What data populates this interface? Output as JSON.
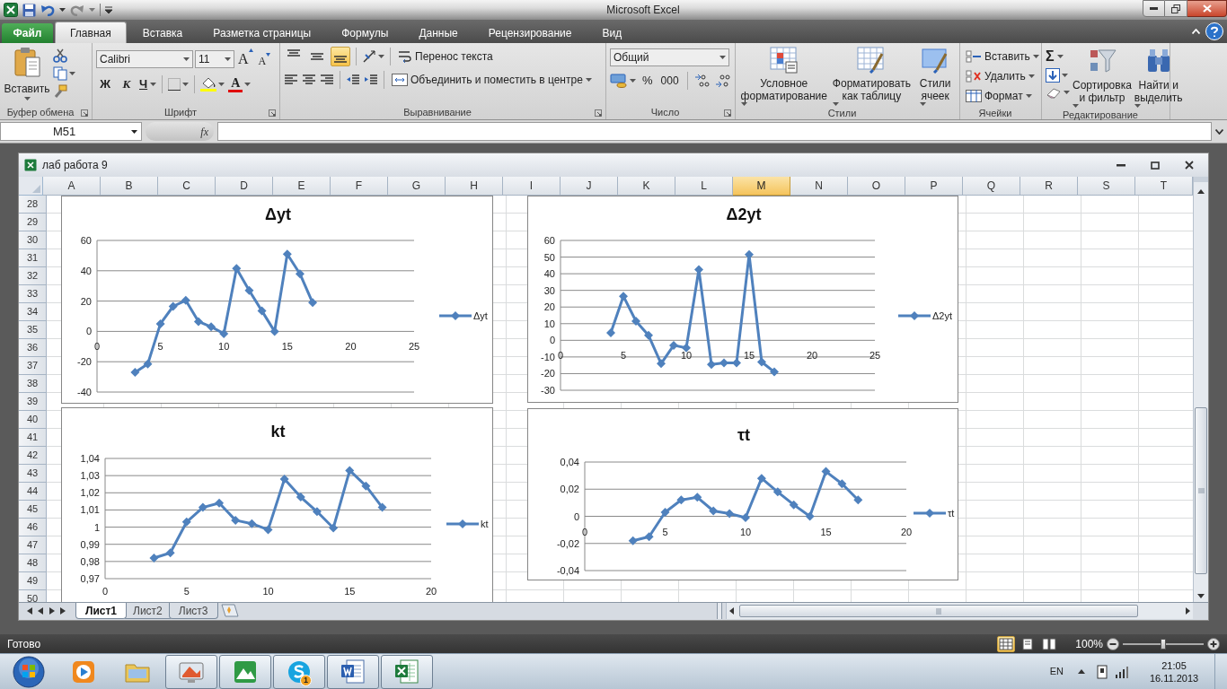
{
  "title_bar": {
    "title": "Microsoft Excel"
  },
  "ribbon_tabs": [
    {
      "label": "Файл",
      "kind": "file",
      "selected": false
    },
    {
      "label": "Главная",
      "kind": "tab",
      "selected": true
    },
    {
      "label": "Вставка",
      "kind": "tab",
      "selected": false
    },
    {
      "label": "Разметка страницы",
      "kind": "tab",
      "selected": false
    },
    {
      "label": "Формулы",
      "kind": "tab",
      "selected": false
    },
    {
      "label": "Данные",
      "kind": "tab",
      "selected": false
    },
    {
      "label": "Рецензирование",
      "kind": "tab",
      "selected": false
    },
    {
      "label": "Вид",
      "kind": "tab",
      "selected": false
    }
  ],
  "clipboard": {
    "paste": "Вставить",
    "group": "Буфер обмена"
  },
  "font": {
    "name": "Calibri",
    "size": "11",
    "grow": "A",
    "shrink": "A",
    "bold": "Ж",
    "italic": "К",
    "underline": "Ч",
    "color_letter": "A",
    "group": "Шрифт"
  },
  "alignment": {
    "vertical": [
      {
        "selected": false
      },
      {
        "selected": false
      },
      {
        "selected": true
      }
    ],
    "wrap": "Перенос текста",
    "merge": "Объединить и поместить в центре",
    "group": "Выравнивание"
  },
  "number": {
    "format": "Общий",
    "percent": "%",
    "thousands": "000",
    "group": "Число"
  },
  "styles": {
    "conditional": "Условное\nформатирование",
    "as_table": "Форматировать\nкак таблицу",
    "cell_styles": "Стили\nячеек",
    "group": "Стили"
  },
  "cells": {
    "insert": "Вставить",
    "delete": "Удалить",
    "format": "Формат",
    "group": "Ячейки"
  },
  "editing": {
    "sum": "Σ",
    "sort": "Сортировка\nи фильтр",
    "find": "Найти и\nвыделить",
    "group": "Редактирование"
  },
  "formula_bar": {
    "name_box": "M51",
    "function": "fx"
  },
  "workbook": {
    "title": "лаб работа 9",
    "columns": [
      {
        "label": "A",
        "selected": false
      },
      {
        "label": "B",
        "selected": false
      },
      {
        "label": "C",
        "selected": false
      },
      {
        "label": "D",
        "selected": false
      },
      {
        "label": "E",
        "selected": false
      },
      {
        "label": "F",
        "selected": false
      },
      {
        "label": "G",
        "selected": false
      },
      {
        "label": "H",
        "selected": false
      },
      {
        "label": "I",
        "selected": false
      },
      {
        "label": "J",
        "selected": false
      },
      {
        "label": "K",
        "selected": false
      },
      {
        "label": "L",
        "selected": false
      },
      {
        "label": "M",
        "selected": true
      },
      {
        "label": "N",
        "selected": false
      },
      {
        "label": "O",
        "selected": false
      },
      {
        "label": "P",
        "selected": false
      },
      {
        "label": "Q",
        "selected": false
      },
      {
        "label": "R",
        "selected": false
      },
      {
        "label": "S",
        "selected": false
      },
      {
        "label": "T",
        "selected": false
      }
    ],
    "rows": [
      "28",
      "29",
      "30",
      "31",
      "32",
      "33",
      "34",
      "35",
      "36",
      "37",
      "38",
      "39",
      "40",
      "41",
      "42",
      "43",
      "44",
      "45",
      "46",
      "47",
      "48",
      "49",
      "50"
    ]
  },
  "charts": [
    {
      "chart_data": {
        "type": "line",
        "title": "Δyt",
        "grid": true,
        "x": [
          3,
          4,
          5,
          6,
          7,
          8,
          9,
          10,
          11,
          12,
          13,
          14,
          15,
          16,
          17
        ],
        "series": [
          {
            "name": "Δyt",
            "color": "#4f81bd",
            "marker": "diamond",
            "values": [
              -27,
              -21.5,
              5,
              16.5,
              20.5,
              6.5,
              3,
              -1.5,
              41.5,
              27,
              13.5,
              0,
              51,
              38,
              19
            ]
          }
        ],
        "xlim": [
          0,
          25
        ],
        "ylim": [
          -40,
          60
        ],
        "xticks": [
          0,
          5,
          10,
          15,
          20,
          25
        ],
        "yticks": [
          -40,
          -20,
          0,
          20,
          40,
          60
        ]
      }
    },
    {
      "chart_data": {
        "type": "line",
        "title": "Δ2yt",
        "grid": true,
        "x": [
          4,
          5,
          6,
          7,
          8,
          9,
          10,
          11,
          12,
          13,
          14,
          15,
          16,
          17
        ],
        "series": [
          {
            "name": "Δ2yt",
            "color": "#4f81bd",
            "marker": "diamond",
            "values": [
              4.5,
              26.5,
              11.5,
              3,
              -14,
              -3,
              -4.5,
              42.5,
              -14.5,
              -13.5,
              -13.5,
              51.5,
              -13,
              -19
            ]
          }
        ],
        "xlim": [
          0,
          25
        ],
        "ylim": [
          -30,
          60
        ],
        "xticks": [
          0,
          5,
          10,
          15,
          20,
          25
        ],
        "yticks": [
          -30,
          -20,
          -10,
          0,
          10,
          20,
          30,
          40,
          50,
          60
        ]
      }
    },
    {
      "chart_data": {
        "type": "line",
        "title": "kt",
        "grid": true,
        "x": [
          3,
          4,
          5,
          6,
          7,
          8,
          9,
          10,
          11,
          12,
          13,
          14,
          15,
          16,
          17
        ],
        "series": [
          {
            "name": "kt",
            "color": "#4f81bd",
            "marker": "diamond",
            "values": [
              0.982,
              0.985,
              1.003,
              1.0115,
              1.014,
              1.004,
              1.002,
              0.9985,
              1.028,
              1.0175,
              1.009,
              0.9995,
              1.033,
              1.024,
              1.0115
            ]
          }
        ],
        "xlim": [
          0,
          20
        ],
        "ylim": [
          0.97,
          1.04
        ],
        "xticks": [
          0,
          5,
          10,
          15,
          20
        ],
        "yticks": [
          {
            "value": 0.97,
            "label": "0,97"
          },
          {
            "value": 0.98,
            "label": "0,98"
          },
          {
            "value": 0.99,
            "label": "0,99"
          },
          {
            "value": 1,
            "label": "1"
          },
          {
            "value": 1.01,
            "label": "1,01"
          },
          {
            "value": 1.02,
            "label": "1,02"
          },
          {
            "value": 1.03,
            "label": "1,03"
          },
          {
            "value": 1.04,
            "label": "1,04"
          }
        ]
      }
    },
    {
      "chart_data": {
        "type": "line",
        "title": "τt",
        "grid": true,
        "x": [
          3,
          4,
          5,
          6,
          7,
          8,
          9,
          10,
          11,
          12,
          13,
          14,
          15,
          16,
          17
        ],
        "series": [
          {
            "name": "τt",
            "color": "#4f81bd",
            "marker": "diamond",
            "values": [
              -0.018,
              -0.015,
              0.003,
              0.012,
              0.014,
              0.004,
              0.002,
              -0.001,
              0.028,
              0.018,
              0.0085,
              0,
              0.033,
              0.024,
              0.012
            ]
          }
        ],
        "xlim": [
          0,
          20
        ],
        "ylim": [
          -0.04,
          0.04
        ],
        "xticks": [
          0,
          5,
          10,
          15,
          20
        ],
        "yticks": [
          {
            "value": -0.04,
            "label": "-0,04"
          },
          {
            "value": -0.02,
            "label": "-0,02"
          },
          {
            "value": 0,
            "label": "0"
          },
          {
            "value": 0.02,
            "label": "0,02"
          },
          {
            "value": 0.04,
            "label": "0,04"
          }
        ]
      }
    }
  ],
  "sheet_tabs": [
    {
      "label": "Лист1",
      "selected": true
    },
    {
      "label": "Лист2",
      "selected": false
    },
    {
      "label": "Лист3",
      "selected": false
    }
  ],
  "status_bar": {
    "status": "Готово",
    "views": [
      {
        "selected": true
      },
      {
        "selected": false
      },
      {
        "selected": false
      }
    ],
    "zoom": "100%",
    "zoom_slider": {
      "level": 0.5
    }
  },
  "taskbar": {
    "apps": [
      {
        "kind": "media",
        "running": false
      },
      {
        "kind": "folder",
        "running": false
      },
      {
        "kind": "monitor",
        "running": true
      },
      {
        "kind": "landscape",
        "running": true
      },
      {
        "kind": "chat",
        "running": true,
        "badge": "1"
      },
      {
        "kind": "document",
        "running": true
      },
      {
        "kind": "spreadsheet",
        "running": true
      }
    ],
    "language": "EN",
    "time": "21:05",
    "date": "16.11.2013"
  }
}
